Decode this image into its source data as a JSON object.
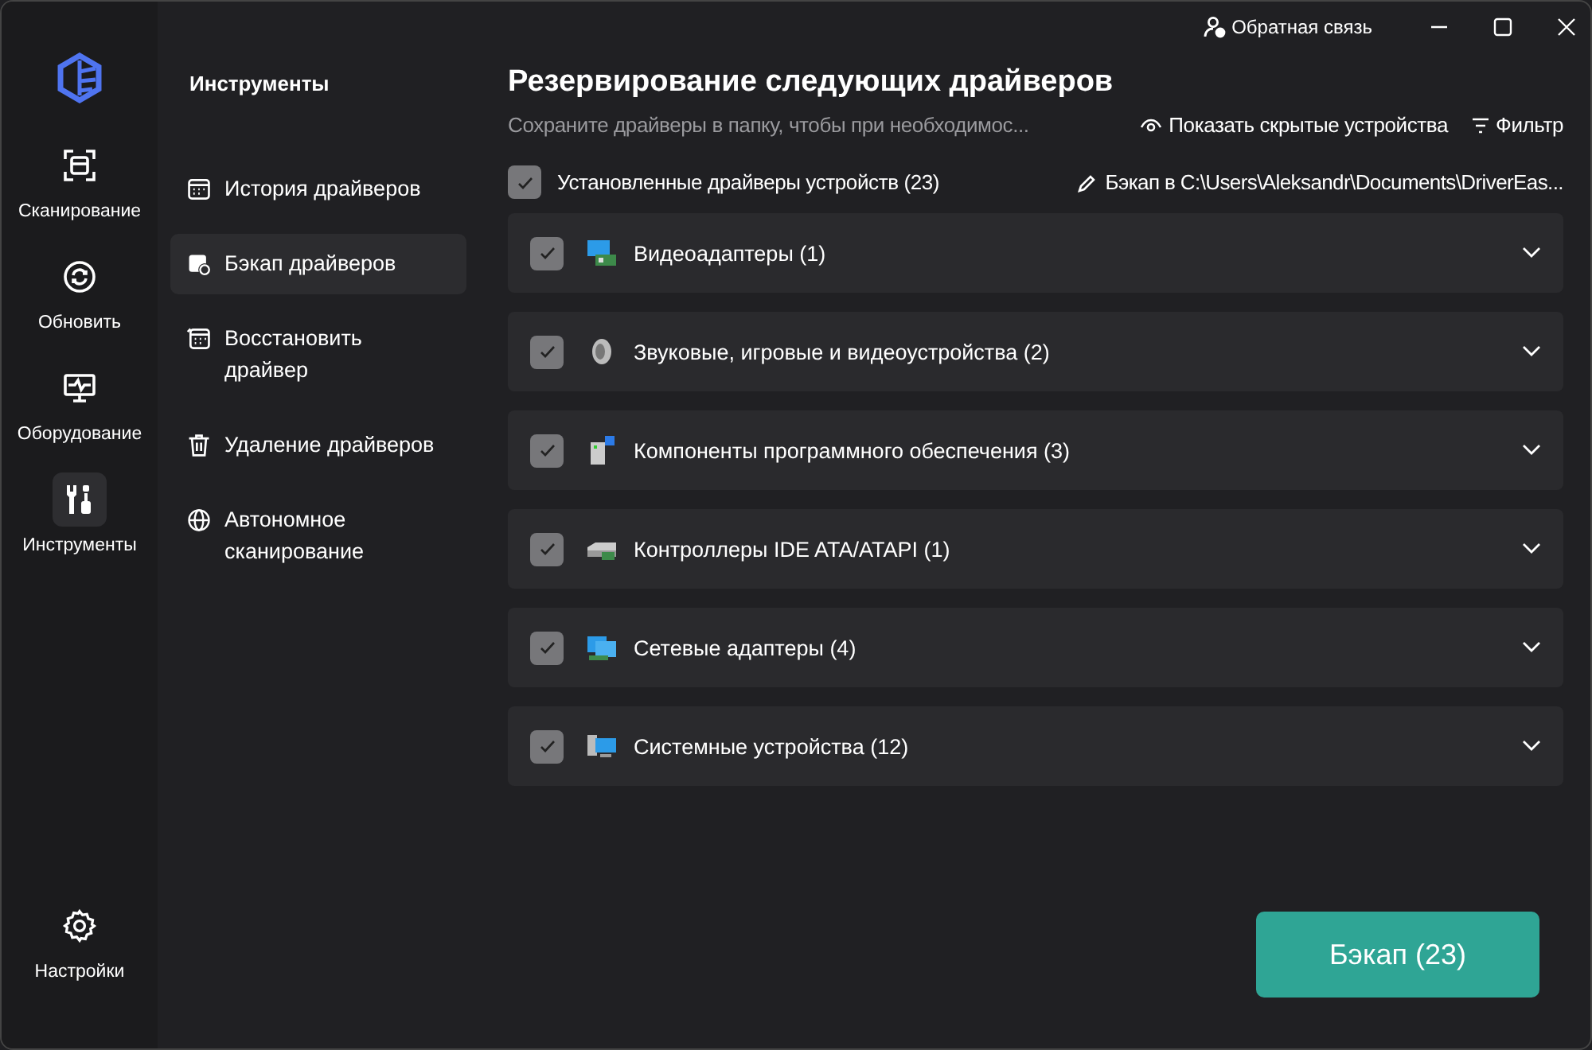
{
  "window": {
    "feedback": "Обратная связь"
  },
  "nav": [
    {
      "label": "Сканирование",
      "selected": false
    },
    {
      "label": "Обновить",
      "selected": false
    },
    {
      "label": "Оборудование",
      "selected": false
    },
    {
      "label": "Инструменты",
      "selected": true
    }
  ],
  "settings": {
    "label": "Настройки"
  },
  "tools": {
    "title": "Инструменты",
    "items": [
      {
        "label": "История драйверов",
        "selected": false
      },
      {
        "label": "Бэкап драйверов",
        "selected": true
      },
      {
        "label": "Восстановить драйвер",
        "selected": false
      },
      {
        "label": "Удаление драйверов",
        "selected": false
      },
      {
        "label": "Автономное сканирование",
        "selected": false
      }
    ]
  },
  "main": {
    "title": "Резервирование следующих драйверов",
    "subtitle": "Сохраните драйверы в папку, чтобы при необходимос...",
    "show_hidden": "Показать скрытые устройства",
    "filter": "Фильтр",
    "all": {
      "label": "Установленные драйверы устройств (23)",
      "checked": true
    },
    "path": "Бэкап в C:\\Users\\Aleksandr\\Documents\\DriverEas...",
    "groups": [
      {
        "label": "Видеоадаптеры (1)",
        "checked": true,
        "expanded": false
      },
      {
        "label": "Звуковые, игровые и видеоустройства (2)",
        "checked": true,
        "expanded": false
      },
      {
        "label": "Компоненты программного обеспечения (3)",
        "checked": true,
        "expanded": false
      },
      {
        "label": "Контроллеры IDE ATA/ATAPI (1)",
        "checked": true,
        "expanded": false
      },
      {
        "label": "Сетевые адаптеры (4)",
        "checked": true,
        "expanded": false
      },
      {
        "label": "Системные устройства (12)",
        "checked": true,
        "expanded": false
      }
    ],
    "backup_button": "Бэкап (23)"
  }
}
